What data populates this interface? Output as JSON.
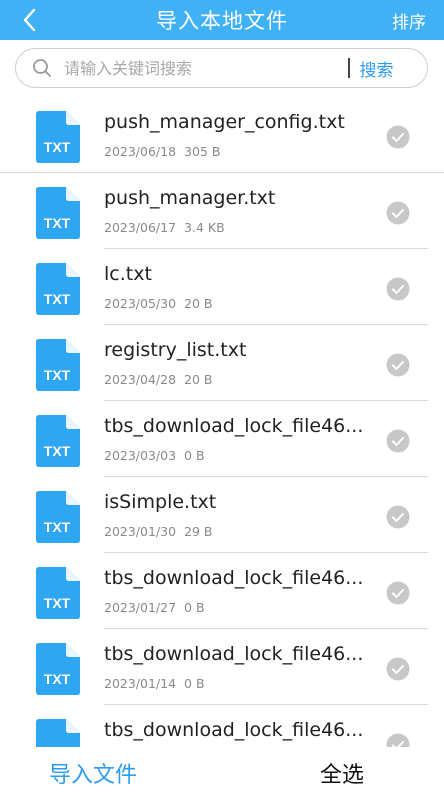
{
  "header": {
    "title": "导入本地文件",
    "sort_label": "排序",
    "back_icon": "chevron-left-icon"
  },
  "search": {
    "placeholder": "请输入关键词搜索",
    "value": "",
    "button_label": "搜索",
    "icon": "search-icon"
  },
  "files": [
    {
      "name": "push_manager_config.txt",
      "date": "2023/06/18",
      "size": "305 B",
      "type": "TXT"
    },
    {
      "name": "push_manager.txt",
      "date": "2023/06/17",
      "size": "3.4 KB",
      "type": "TXT"
    },
    {
      "name": "lc.txt",
      "date": "2023/05/30",
      "size": "20 B",
      "type": "TXT"
    },
    {
      "name": "registry_list.txt",
      "date": "2023/04/28",
      "size": "20 B",
      "type": "TXT"
    },
    {
      "name": "tbs_download_lock_file46...",
      "date": "2023/03/03",
      "size": "0 B",
      "type": "TXT"
    },
    {
      "name": "isSimple.txt",
      "date": "2023/01/30",
      "size": "29 B",
      "type": "TXT"
    },
    {
      "name": "tbs_download_lock_file46...",
      "date": "2023/01/27",
      "size": "0 B",
      "type": "TXT"
    },
    {
      "name": "tbs_download_lock_file46...",
      "date": "2023/01/14",
      "size": "0 B",
      "type": "TXT"
    },
    {
      "name": "tbs_download_lock_file46...",
      "date": "",
      "size": "",
      "type": "TXT"
    }
  ],
  "footer": {
    "import_label": "导入文件",
    "select_all_label": "全选"
  },
  "colors": {
    "accent": "#41b1f5",
    "link": "#2e9cf0",
    "check": "#c8c8c8"
  }
}
